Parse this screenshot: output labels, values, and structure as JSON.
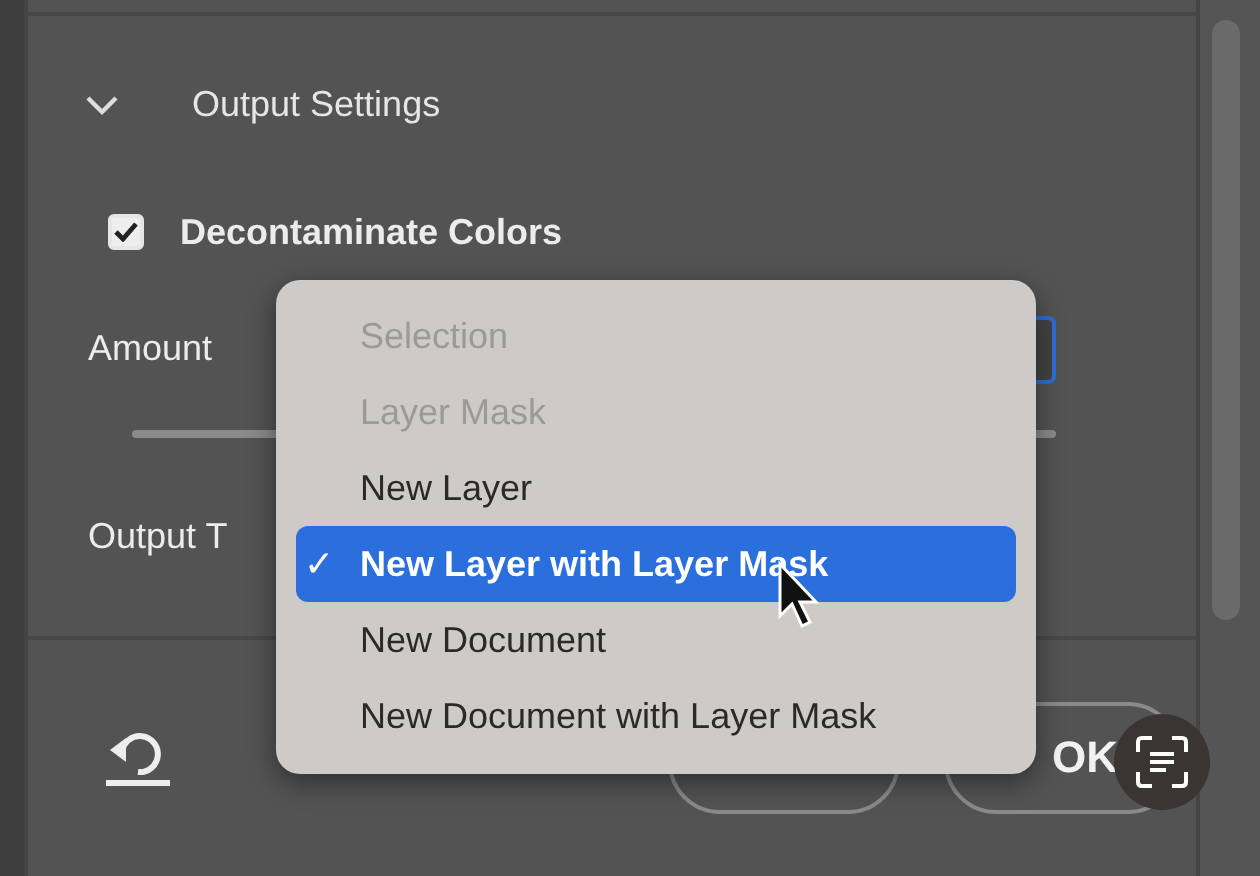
{
  "section": {
    "title": "Output Settings",
    "expanded": true
  },
  "decontaminate": {
    "label": "Decontaminate Colors",
    "checked": true
  },
  "amount": {
    "label": "Amount"
  },
  "output_to": {
    "label": "Output T"
  },
  "menu": {
    "check_mark": "✓",
    "items": [
      {
        "label": "Selection",
        "disabled": true,
        "selected": false
      },
      {
        "label": "Layer Mask",
        "disabled": true,
        "selected": false
      },
      {
        "label": "New Layer",
        "disabled": false,
        "selected": false
      },
      {
        "label": "New Layer with Layer Mask",
        "disabled": false,
        "selected": true
      },
      {
        "label": "New Document",
        "disabled": false,
        "selected": false
      },
      {
        "label": "New Document with Layer Mask",
        "disabled": false,
        "selected": false
      }
    ]
  },
  "footer": {
    "ok": "OK"
  }
}
